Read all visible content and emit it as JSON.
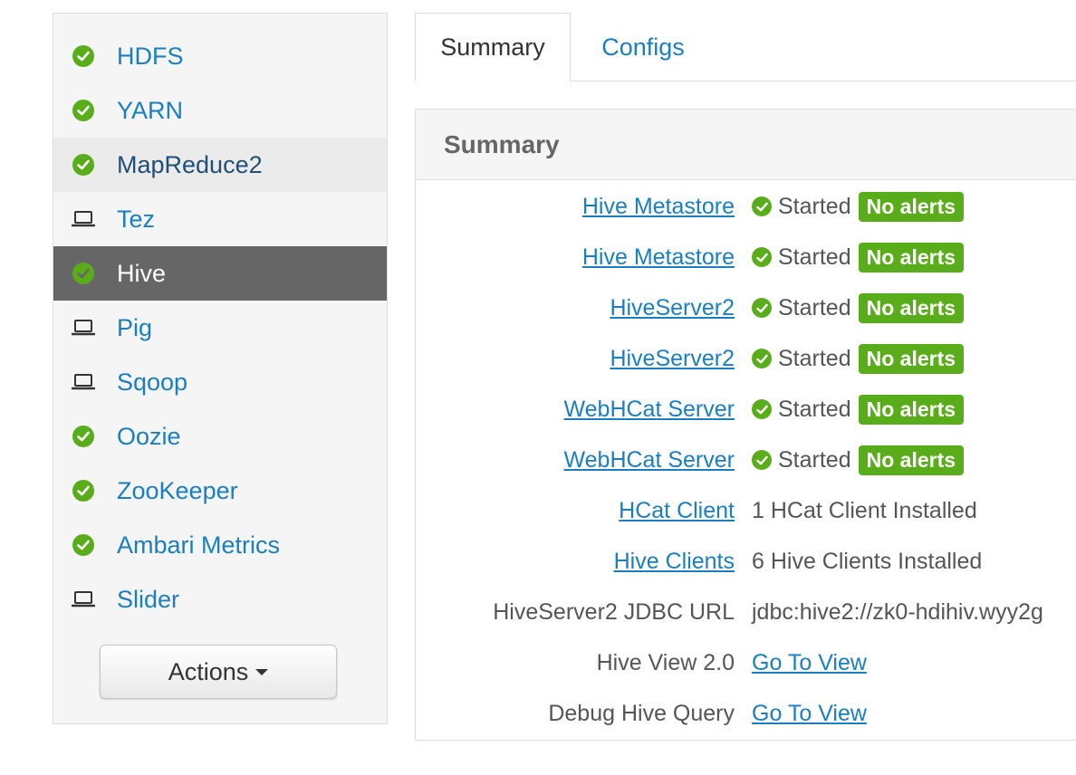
{
  "sidebar": {
    "items": [
      {
        "label": "HDFS",
        "icon": "check-circle-icon"
      },
      {
        "label": "YARN",
        "icon": "check-circle-icon"
      },
      {
        "label": "MapReduce2",
        "icon": "check-circle-icon"
      },
      {
        "label": "Tez",
        "icon": "laptop-icon"
      },
      {
        "label": "Hive",
        "icon": "check-circle-icon"
      },
      {
        "label": "Pig",
        "icon": "laptop-icon"
      },
      {
        "label": "Sqoop",
        "icon": "laptop-icon"
      },
      {
        "label": "Oozie",
        "icon": "check-circle-icon"
      },
      {
        "label": "ZooKeeper",
        "icon": "check-circle-icon"
      },
      {
        "label": "Ambari Metrics",
        "icon": "check-circle-icon"
      },
      {
        "label": "Slider",
        "icon": "laptop-icon"
      }
    ],
    "actions_label": "Actions"
  },
  "tabs": {
    "summary": "Summary",
    "configs": "Configs"
  },
  "panel": {
    "title": "Summary",
    "rows": [
      {
        "label": "Hive Metastore",
        "status": "Started",
        "badge": "No alerts"
      },
      {
        "label": "Hive Metastore",
        "status": "Started",
        "badge": "No alerts"
      },
      {
        "label": "HiveServer2",
        "status": "Started",
        "badge": "No alerts"
      },
      {
        "label": "HiveServer2",
        "status": "Started",
        "badge": "No alerts"
      },
      {
        "label": "WebHCat Server",
        "status": "Started",
        "badge": "No alerts"
      },
      {
        "label": "WebHCat Server",
        "status": "Started",
        "badge": "No alerts"
      },
      {
        "label": "HCat Client",
        "value": "1 HCat Client Installed"
      },
      {
        "label": "Hive Clients",
        "value": "6 Hive Clients Installed"
      },
      {
        "label": "HiveServer2 JDBC URL",
        "value": "jdbc:hive2://zk0-hdihiv.wyy2g"
      },
      {
        "label": "Hive View 2.0",
        "link": "Go To View"
      },
      {
        "label": "Debug Hive Query",
        "link": "Go To View"
      }
    ]
  },
  "colors": {
    "link": "#1a7fc1",
    "ok_green": "#5aad1a",
    "active_item_bg": "#666666"
  }
}
